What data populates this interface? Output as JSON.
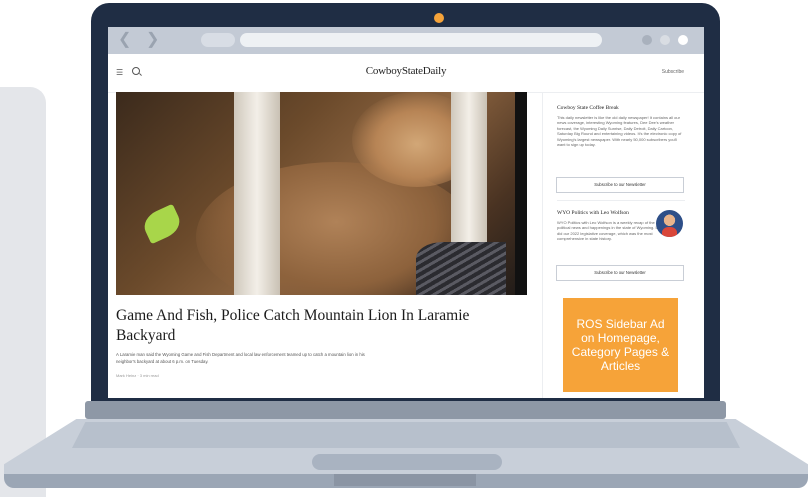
{
  "site": {
    "logo": "CowboyStateDaily",
    "subscribe": "Subscribe"
  },
  "article": {
    "headline": "Game And Fish, Police Catch Mountain Lion In Laramie Backyard",
    "summary": "A Laramie man said the Wyoming Game and Fish Department and local law enforcement teamed up to catch a mountain lion in his neighbor's backyard at about 6 p.m. on Tuesday.",
    "byline": "Mark Heinz · 3 min read"
  },
  "sidebar": {
    "newsletter1": {
      "title": "Cowboy State Coffee Break",
      "description": "This daily newsletter is like the old daily newspaper! It contains all our news coverage, interesting Wyoming features, Dee Dee's weather forecast, the Wyoming Daily Sunrise, Daily Detroit, Daily Cartoon, Saturday Big Round and entertaining videos. It's the electronic copy of Wyoming's largest newspaper. With nearly 50,000 subscribers you'll want to sign up today.",
      "button": "Subscribe to our Newsletter"
    },
    "newsletter2": {
      "title": "WYO Politics with Leo Wolfson",
      "description": "WYO Politics with Leo Wolfson is a weekly recap of the political news and happenings in the state of Wyoming. Leo did our 2022 legislative coverage, which was the most comprehensive in state history.",
      "button": "Subscribe to our Newsletter"
    },
    "ad": "ROS Sidebar Ad on Homepage, Category Pages & Articles"
  },
  "colors": {
    "lid": "#1f2d44",
    "camera": "#f5a33a",
    "ad": "#f6a339",
    "chrome": "#c3cad5"
  },
  "icons": {
    "back": "chevron-left-icon",
    "forward": "chevron-right-icon",
    "menu": "hamburger-icon",
    "search": "search-icon"
  }
}
